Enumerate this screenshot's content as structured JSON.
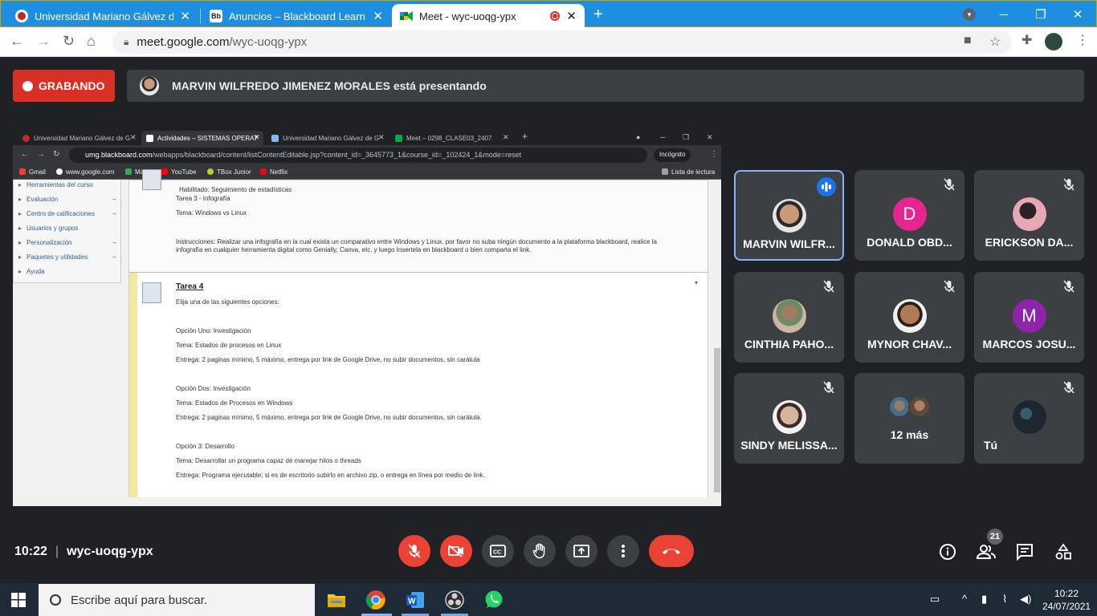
{
  "browser": {
    "tabs": [
      {
        "title": "Universidad Mariano Gálvez de G",
        "icon": "umg-favicon"
      },
      {
        "title": "Anuncios – Blackboard Learn",
        "icon": "blackboard-favicon"
      },
      {
        "title": "Meet - wyc-uoqg-ypx",
        "icon": "meet-favicon"
      }
    ],
    "url_domain": "meet.google.com",
    "url_path": "/wyc-uoqg-ypx"
  },
  "meet": {
    "recording_label": "GRABANDO",
    "presenting_text": "MARVIN WILFREDO JIMENEZ MORALES está presentando",
    "time": "10:22",
    "meeting_code": "wyc-uoqg-ypx",
    "participant_count": "21",
    "participants": [
      {
        "name": "MARVIN WILFR...",
        "initial": "",
        "muted": false,
        "speaking": true,
        "color": "#6b5a4e"
      },
      {
        "name": "DONALD OBD...",
        "initial": "D",
        "muted": true,
        "speaking": false,
        "color": "#e52592"
      },
      {
        "name": "ERICKSON DA...",
        "initial": "",
        "muted": true,
        "speaking": false,
        "color": "#b76a7a"
      },
      {
        "name": "CINTHIA PAHO...",
        "initial": "",
        "muted": true,
        "speaking": false,
        "color": "#8a7b6a"
      },
      {
        "name": "MYNOR CHAV...",
        "initial": "",
        "muted": true,
        "speaking": false,
        "color": "#a56a4b"
      },
      {
        "name": "MARCOS JOSU...",
        "initial": "M",
        "muted": true,
        "speaking": false,
        "color": "#8e24aa"
      },
      {
        "name": "SINDY MELISSA...",
        "initial": "",
        "muted": true,
        "speaking": false,
        "color": "#d9c7bd"
      },
      {
        "name": "12 más",
        "initial": "",
        "muted": false,
        "speaking": false,
        "color": "#3c4043"
      },
      {
        "name": "Tú",
        "initial": "",
        "muted": true,
        "speaking": false,
        "color": "#2e3b46"
      }
    ],
    "accent_red": "#ea4335",
    "accent_blue": "#8ab4f8"
  },
  "shared": {
    "tabs": [
      "Universidad Mariano Gálvez de G",
      "Actividades – SISTEMAS OPERAT",
      "Universidad Mariano Gálvez de G",
      "Meet – 0298_CLASE03_2407"
    ],
    "url_domain": "umg.blackboard.com",
    "url_path": "/webapps/blackboard/content/listContentEditable.jsp?content_id=_3645773_1&course_id=_102424_1&mode=reset",
    "incognito": "Incógnito",
    "bookmarks": [
      "Gmail",
      "www.google.com",
      "Maps",
      "YouTube",
      "TBox Junior",
      "Netflix"
    ],
    "reading_list": "Lista de lectura",
    "menu": [
      "Herramientas del curso",
      "Evaluación",
      "Centro de calificaciones",
      "Usuarios y grupos",
      "Personalización",
      "Paquetes y utilidades",
      "Ayuda"
    ],
    "block1": {
      "habilitado": "Habilitado:  Seguimiento de estadísticas",
      "title": "Tarea 3 - Infografía",
      "tema": "Tema: Windows vs Linux",
      "instr1": "Instrucciones: Realizar una infografía en la cual exista un comparativo entre Windows y Linux, por favor no suba ningún documento a la plataforma blackboard, realice la",
      "instr2": "infografía en cualquier herramienta digital como Genially, Canva, etc. y luego Insertela en blackboard o bien comparta el link."
    },
    "block2": {
      "title": "Tarea 4",
      "intro": "Elija una de las siguientes opciones:",
      "o1": "Opción Uno: Investigación",
      "o1_tema": "Tema:  Estados de procesos en Linux",
      "o1_entrega": "Entrega: 2 paginas mínimo, 5 máximo, entrega por link de Google Drive, no subir documentos, sin carátula",
      "o2": "Opción Dos: Investigación",
      "o2_tema": "Tema: Estados de Procesos en Windows",
      "o2_entrega": "Entrega: 2 paginas mínimo, 5 máximo, entrega por link de Google Drive, no subir documentos, sin carátula.",
      "o3": "Opción 3: Desarrollo",
      "o3_tema": "Tema: Desarrollar un programa capaz de manejar hilos o threads",
      "o3_entrega": "Entrega: Programa ejecutable; si es de escritorio subirlo en archivo zip, o entrega en línea por medio de link."
    }
  },
  "taskbar": {
    "search_placeholder": "Escribe aquí para buscar.",
    "time": "10:22",
    "date": "24/07/2021"
  }
}
